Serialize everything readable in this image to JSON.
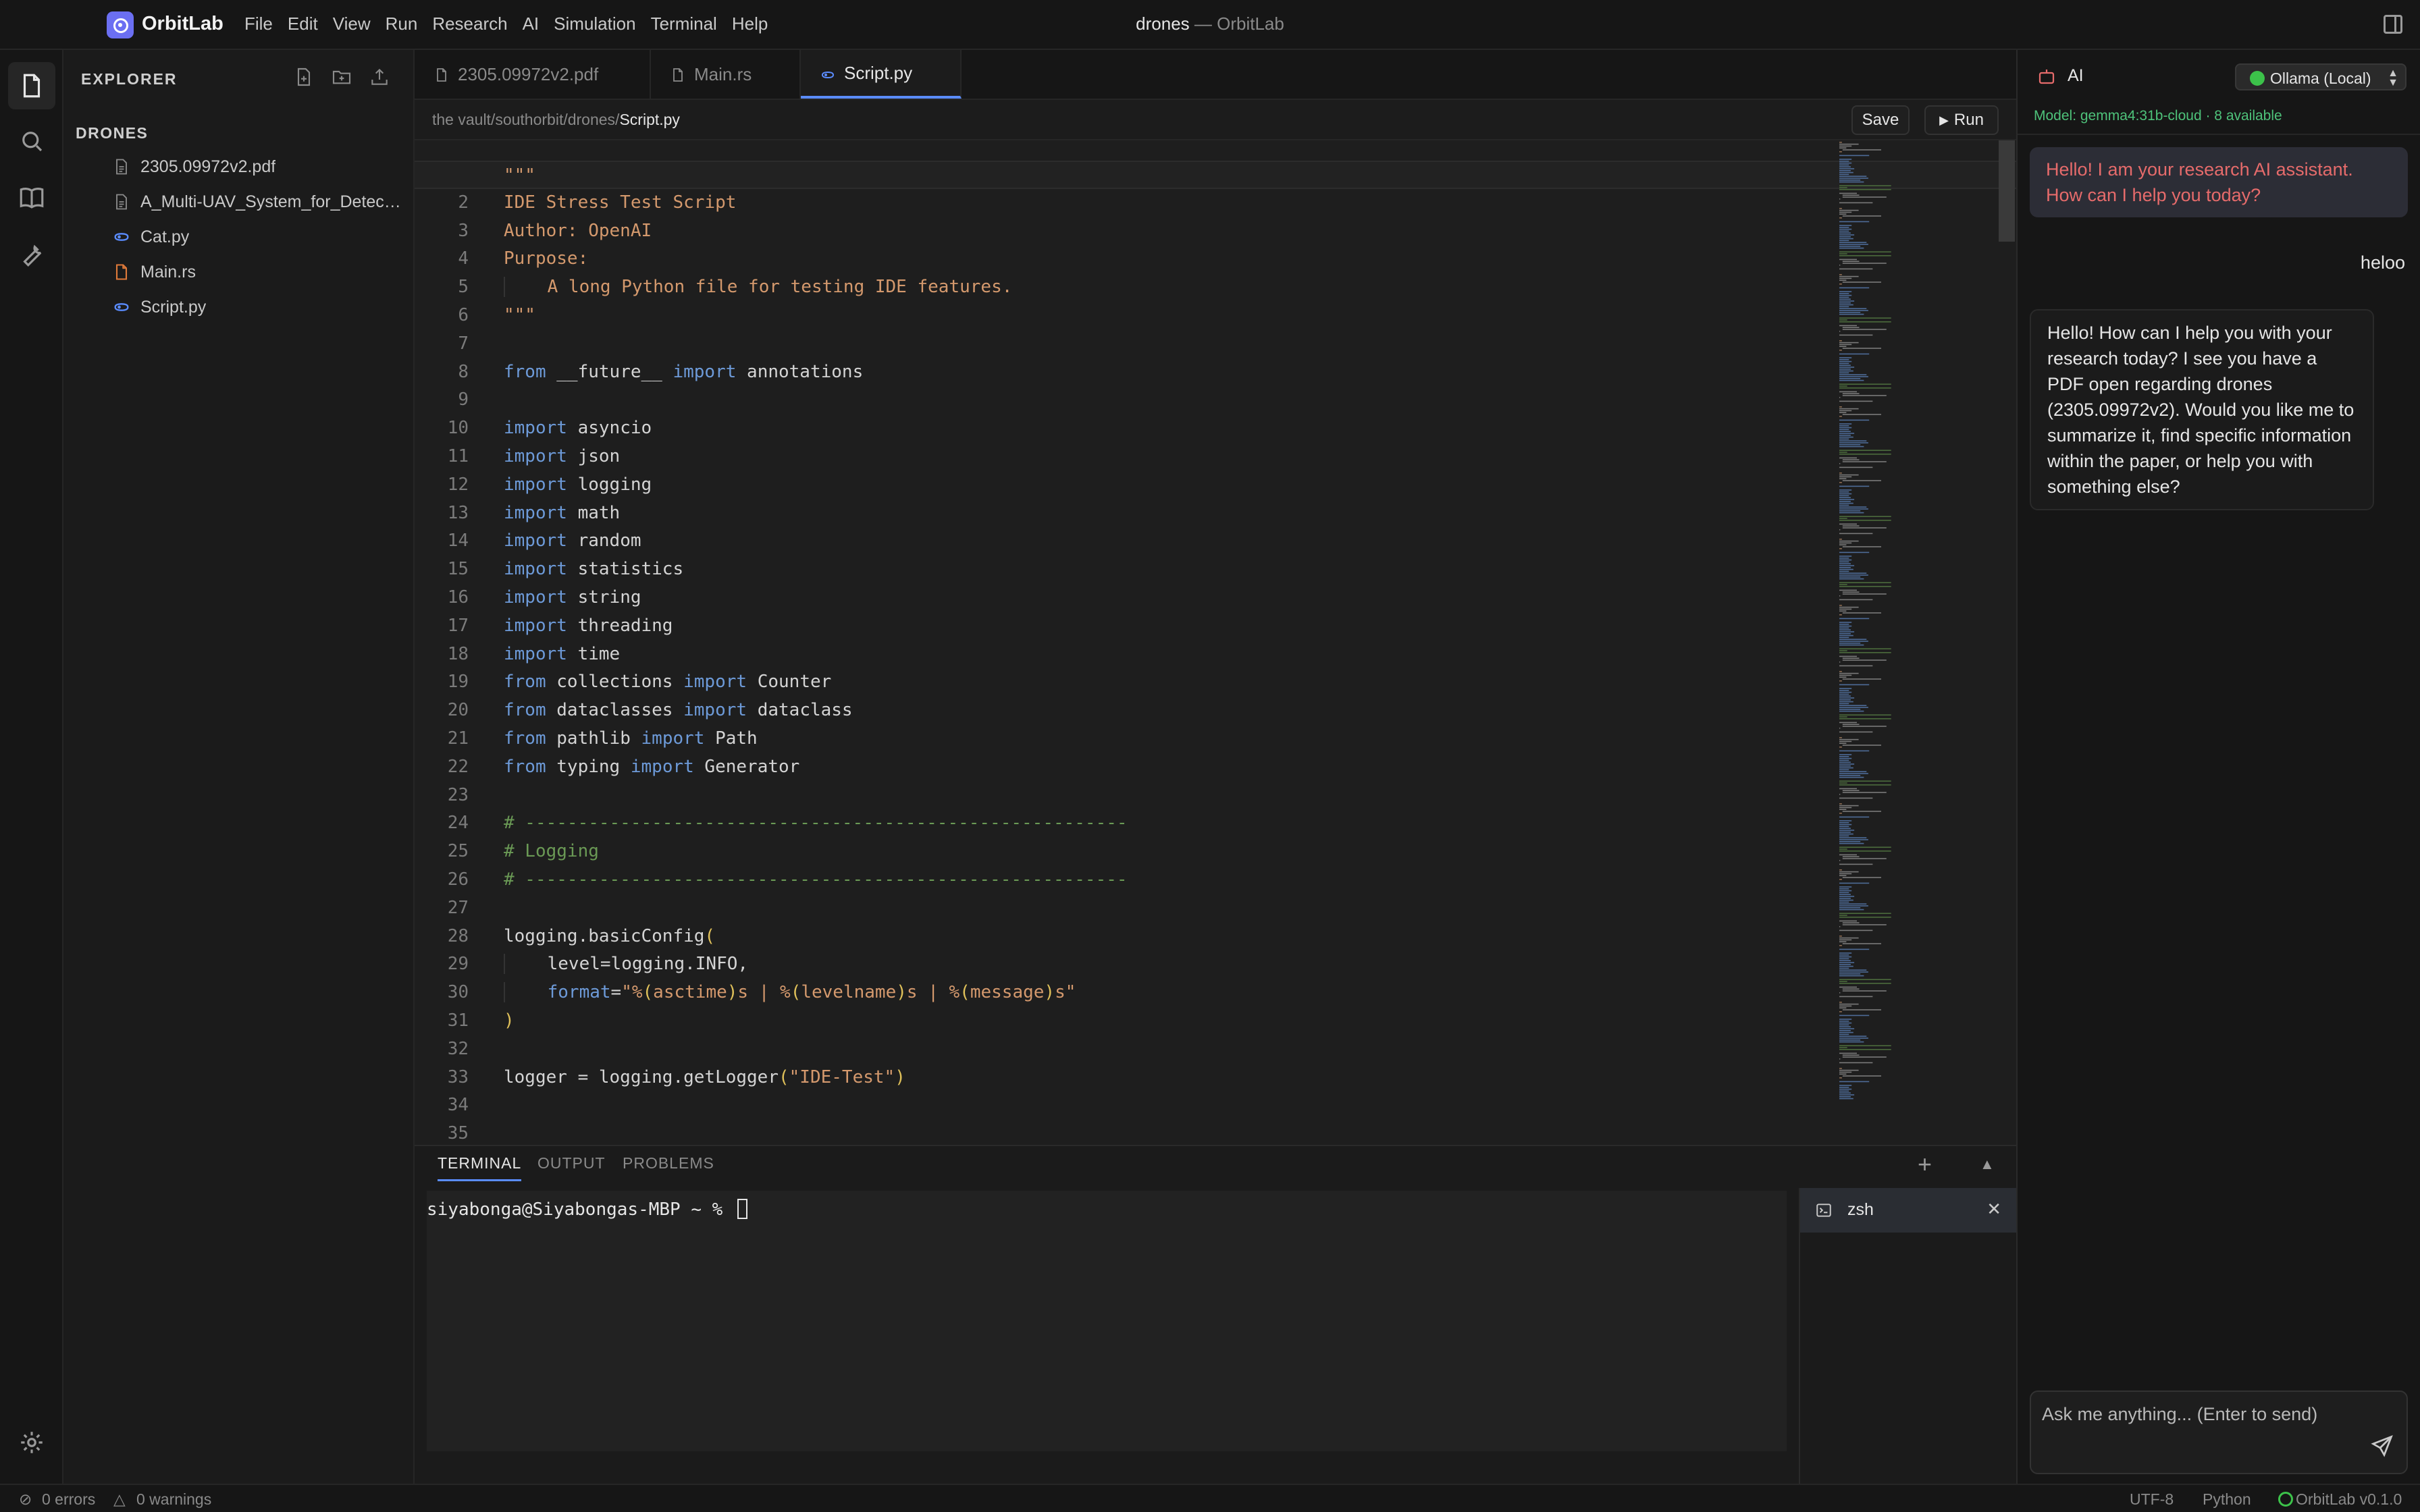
{
  "app": {
    "name": "OrbitLab",
    "version_label": "OrbitLab v0.1.0"
  },
  "menu": [
    "File",
    "Edit",
    "View",
    "Run",
    "Research",
    "AI",
    "Simulation",
    "Terminal",
    "Help"
  ],
  "window_title": {
    "project": "drones",
    "sep": " — ",
    "app": "OrbitLab"
  },
  "explorer": {
    "title": "EXPLORER",
    "folder": "DRONES",
    "files": [
      {
        "name": "2305.09972v2.pdf",
        "icon": "file-icon"
      },
      {
        "name": "A_Multi-UAV_System_for_Detection...",
        "icon": "file-icon"
      },
      {
        "name": "Cat.py",
        "icon": "python-icon"
      },
      {
        "name": "Main.rs",
        "icon": "rust-file-icon"
      },
      {
        "name": "Script.py",
        "icon": "python-icon"
      }
    ]
  },
  "tabs": [
    {
      "label": "2305.09972v2.pdf",
      "icon": "file-icon",
      "active": false
    },
    {
      "label": "Main.rs",
      "icon": "file-icon",
      "active": false
    },
    {
      "label": "Script.py",
      "icon": "python-icon",
      "active": true
    }
  ],
  "breadcrumb": {
    "path": "the vault/southorbit/drones/",
    "file": "Script.py"
  },
  "editor_actions": {
    "save": "Save",
    "run": "Run"
  },
  "code": {
    "current_line": 1,
    "lines": [
      "\"\"\"",
      "IDE Stress Test Script",
      "Author: OpenAI",
      "Purpose:",
      "    A long Python file for testing IDE features.",
      "\"\"\"",
      "",
      "from __future__ import annotations",
      "",
      "import asyncio",
      "import json",
      "import logging",
      "import math",
      "import random",
      "import statistics",
      "import string",
      "import threading",
      "import time",
      "from collections import Counter",
      "from dataclasses import dataclass",
      "from pathlib import Path",
      "from typing import Generator",
      "",
      "# ---------------------------------------------------------",
      "# Logging",
      "# ---------------------------------------------------------",
      "",
      "logging.basicConfig(",
      "    level=logging.INFO,",
      "    format=\"%(asctime)s | %(levelname)s | %(message)s\"",
      ")",
      "",
      "logger = logging.getLogger(\"IDE-Test\")",
      "",
      ""
    ]
  },
  "panel": {
    "tabs": [
      "TERMINAL",
      "OUTPUT",
      "PROBLEMS"
    ],
    "active_tab": "TERMINAL",
    "prompt": "siyabonga@Siyabongas-MBP ~ % ",
    "terminals": [
      {
        "name": "zsh"
      }
    ]
  },
  "ai": {
    "label": "AI",
    "provider": "Ollama (Local)",
    "model_info": "Model: gemma4:31b-cloud · 8 available",
    "messages": [
      {
        "role": "assistant",
        "text": "Hello! I am your research AI assistant. How can I help you today?"
      },
      {
        "role": "user",
        "text": "heloo"
      },
      {
        "role": "assistant",
        "text": "Hello! How can I help you with your research today? I see you have a PDF open regarding drones (2305.09972v2). Would you like me to summarize it, find specific information within the paper, or help you with something else?"
      }
    ],
    "input_placeholder": "Ask me anything... (Enter to send)"
  },
  "status": {
    "errors": "0 errors",
    "warnings": "0 warnings",
    "encoding": "UTF-8",
    "language": "Python"
  },
  "colors": {
    "accent": "#5a8cff",
    "logo": "#6b6ff2",
    "error_text": "#e66b6b",
    "ok_green": "#4ec27a",
    "keyword": "#6d9ad8",
    "string": "#d4996d",
    "comment": "#6a9955"
  }
}
